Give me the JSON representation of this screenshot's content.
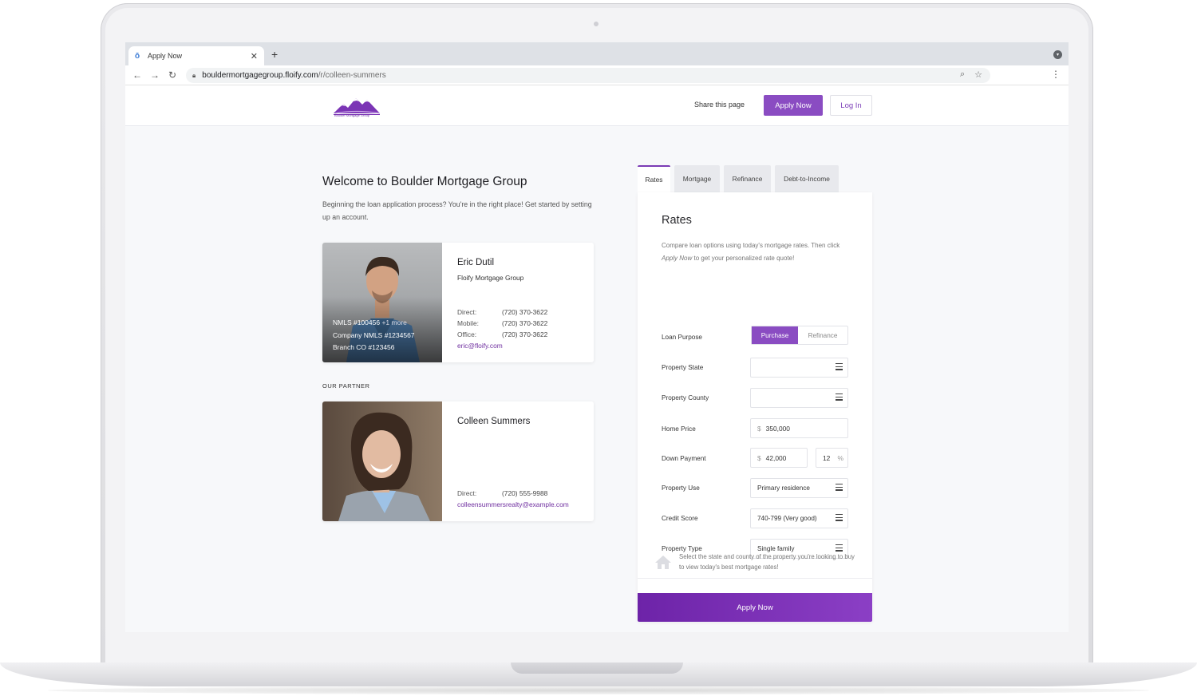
{
  "browser": {
    "tab_title": "Apply Now",
    "new_tab": "+",
    "url_host": "bouldermortgagegroup.floify.com",
    "url_path": "/r/colleen-summers"
  },
  "header": {
    "logo_text": "Boulder Mortgage Group",
    "share_label": "Share this page",
    "apply_label": "Apply Now",
    "login_label": "Log In"
  },
  "welcome": {
    "title": "Welcome to Boulder Mortgage Group",
    "text": "Beginning the loan application process? You're in the right place! Get started by setting up an account."
  },
  "loan_officer": {
    "name": "Eric Dutil",
    "org": "Floify Mortgage Group",
    "nmls": "NMLS #100456",
    "nmls_more": "+1 more",
    "company_nmls": "Company NMLS #1234567",
    "branch": "Branch CO #123456",
    "direct_label": "Direct:",
    "direct": "(720) 370-3622",
    "mobile_label": "Mobile:",
    "mobile": "(720) 370-3622",
    "office_label": "Office:",
    "office": "(720) 370-3622",
    "email": "eric@floify.com"
  },
  "partner": {
    "section_label": "OUR PARTNER",
    "name": "Colleen Summers",
    "direct_label": "Direct:",
    "direct": "(720) 555-9988",
    "email": "colleensummersrealty@example.com"
  },
  "widget": {
    "tabs": [
      "Rates",
      "Mortgage",
      "Refinance",
      "Debt-to-Income"
    ],
    "title": "Rates",
    "desc_before": "Compare loan options using today's mortgage rates. Then click ",
    "desc_em": "Apply Now",
    "desc_after": " to get your personalized rate quote!",
    "loan_purpose_label": "Loan Purpose",
    "loan_purpose_on": "Purchase",
    "loan_purpose_off": "Refinance",
    "property_state_label": "Property State",
    "property_state_value": "",
    "property_county_label": "Property County",
    "property_county_value": "",
    "home_price_label": "Home Price",
    "currency": "$",
    "home_price_value": "350,000",
    "down_payment_label": "Down Payment",
    "down_payment_value": "42,000",
    "down_payment_pct": "12",
    "pct_symbol": "%",
    "property_use_label": "Property Use",
    "property_use_value": "Primary residence",
    "credit_score_label": "Credit Score",
    "credit_score_value": "740-799 (Very good)",
    "property_type_label": "Property Type",
    "property_type_value": "Single family",
    "footer_note": "Select the state and county of the property you're looking to buy to view today's best mortgage rates!",
    "apply_label": "Apply Now"
  },
  "colors": {
    "brand_purple": "#8a4cc2",
    "button_purple_dark": "#6d23a8",
    "link_purple": "#7030a0"
  }
}
